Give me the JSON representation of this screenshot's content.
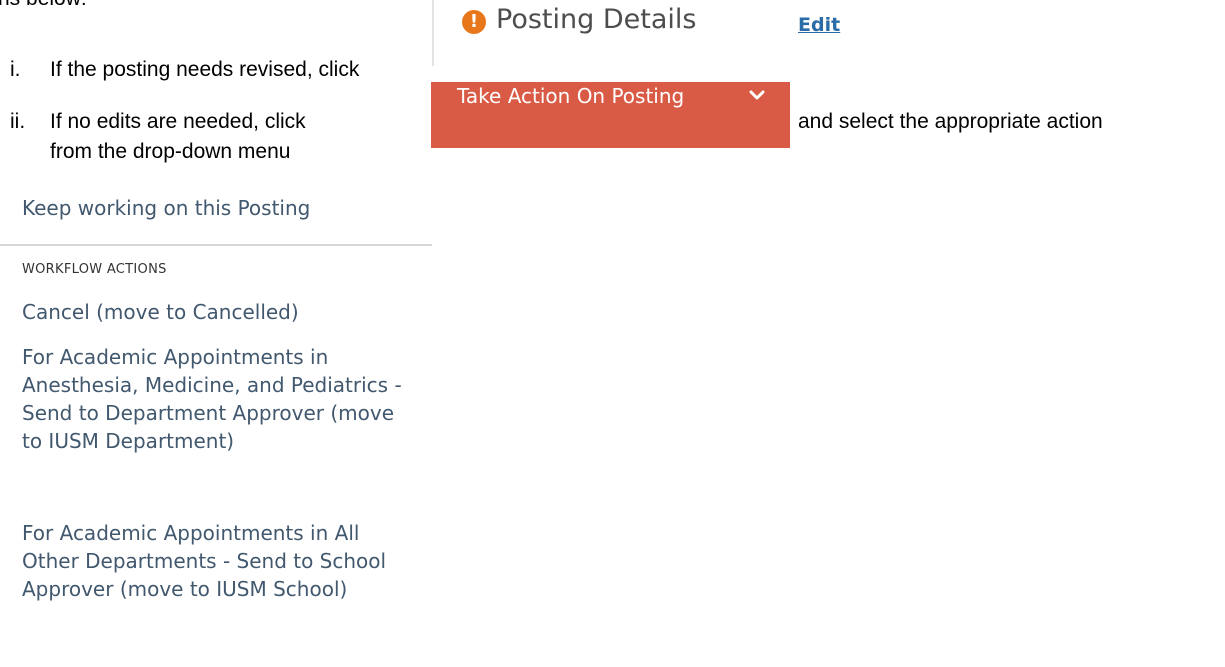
{
  "intro_fragment": "ns below:",
  "steps": [
    {
      "marker": "i.",
      "text": "If the posting needs revised, click"
    },
    {
      "marker": "ii.",
      "text_before": "If no edits are needed, click",
      "text_after": "and select the appropriate action",
      "continuation": "from the drop-down menu"
    }
  ],
  "posting_header": {
    "icon": "exclamation-icon",
    "title": "Posting Details",
    "edit_label": "Edit"
  },
  "action_button": {
    "label": "Take Action On Posting",
    "icon": "chevron-down-icon"
  },
  "menu": {
    "top_item": "Keep working on this Posting",
    "section_label": "WORKFLOW ACTIONS",
    "items": [
      "Cancel (move to Cancelled)",
      "For Academic Appointments in Anesthesia, Medicine, and Pediatrics - Send to Department Approver (move to IUSM Department)",
      "For Academic Appointments in All Other Departments - Send to School Approver (move to IUSM School)"
    ]
  },
  "colors": {
    "accent": "#d95b45",
    "link": "#2a6ca8",
    "alert": "#e8771b",
    "menu_text": "#41586e"
  }
}
